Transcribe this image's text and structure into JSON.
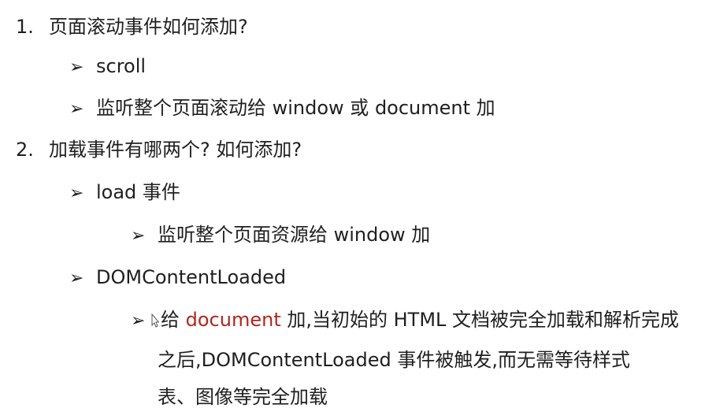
{
  "items": [
    {
      "number": "1.",
      "question": "页面滚动事件如何添加?",
      "subitems": [
        {
          "arrow": "➢",
          "text": "scroll"
        },
        {
          "arrow": "➢",
          "text": "监听整个页面滚动给 window 或 document 加"
        }
      ]
    },
    {
      "number": "2.",
      "question": "加载事件有哪两个? 如何添加?",
      "subitems": [
        {
          "arrow": "➢",
          "text": "load 事件",
          "children": [
            {
              "arrow": "➢",
              "text": "监听整个页面资源给 window 加"
            }
          ]
        },
        {
          "arrow": "➢",
          "text": "DOMContentLoaded",
          "children": [
            {
              "arrow": "➢",
              "prefix": "给 ",
              "highlight": "document",
              "suffix": " 加,当初始的 HTML 文档被完全加载和解析完成",
              "line2": "之后,DOMContentLoaded 事件被触发,而无需等待样式",
              "line3": "表、图像等完全加载"
            }
          ]
        }
      ]
    }
  ],
  "colors": {
    "text": "#1f1f1f",
    "highlight": "#b5241c",
    "background": "#ffffff"
  }
}
